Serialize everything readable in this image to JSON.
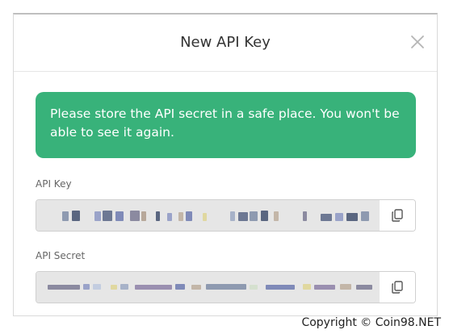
{
  "dialog": {
    "title": "New API Key",
    "close_icon": "close-icon"
  },
  "alert": {
    "message": "Please store the API secret in a safe place. You won't be able to see it again.",
    "color": "#38b27a"
  },
  "api_key": {
    "label": "API Key",
    "copy_icon": "copy-icon"
  },
  "api_secret": {
    "label": "API Secret",
    "copy_icon": "copy-icon"
  },
  "watermark": "Copyright © Coin98.NET"
}
